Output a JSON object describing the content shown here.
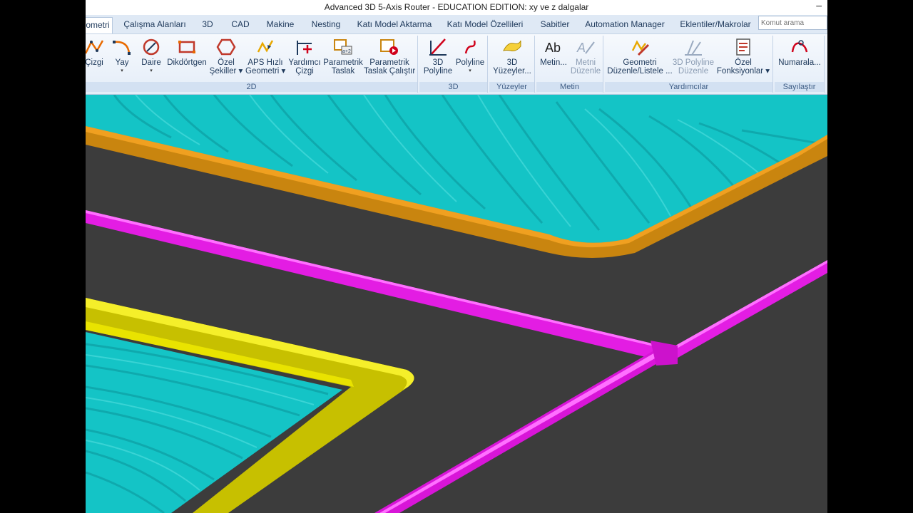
{
  "window": {
    "title": "Advanced 3D 5-Axis Router - EDUCATION EDITION: xy ve z dalgalar",
    "minimize_glyph": "–"
  },
  "tabs": [
    "ometri",
    "Çalışma Alanları",
    "3D",
    "CAD",
    "Makine",
    "Nesting",
    "Katı Model Aktarma",
    "Katı Model Özellileri",
    "Sabitler",
    "Automation Manager",
    "Eklentiler/Makrolar"
  ],
  "search": {
    "placeholder": "Komut arama"
  },
  "groups": {
    "g2d": "2D",
    "g3d": "3D",
    "yuzeyler": "Yüzeyler",
    "metin": "Metin",
    "yardimcilar": "Yardımcılar",
    "sayilastir": "Sayılaştır"
  },
  "buttons": {
    "cizgi": [
      "Çizgi",
      ""
    ],
    "yay": [
      "Yay",
      "▾"
    ],
    "daire": [
      "Daire",
      "▾"
    ],
    "dikdortgen": [
      "Dikdörtgen",
      ""
    ],
    "ozel_sekiller": [
      "Özel",
      "Şekiller ▾"
    ],
    "aps": [
      "APS Hızlı",
      "Geometri ▾"
    ],
    "yardimci_cizgi": [
      "Yardımcı",
      "Çizgi"
    ],
    "parametrik_taslak": [
      "Parametrik",
      "Taslak"
    ],
    "parametrik_calistir": [
      "Parametrik",
      "Taslak Çalıştır"
    ],
    "polyline3d": [
      "3D",
      "Polyline"
    ],
    "polyline": [
      "Polyline",
      "▾"
    ],
    "yuzeyler3d": [
      "3D",
      "Yüzeyler..."
    ],
    "metin": [
      "Metin...",
      ""
    ],
    "metni_duzenle": [
      "Metni",
      "Düzenle"
    ],
    "geometri_duzenle": [
      "Geometri",
      "Düzenle/Listele ..."
    ],
    "polyline_duzenle": [
      "3D Polyline",
      "Düzenle"
    ],
    "ozel_fonksiyonlar": [
      "Özel",
      "Fonksiyonlar ▾"
    ],
    "numarala": [
      "Numarala...",
      ""
    ]
  },
  "colors": {
    "accent": "#1e395b",
    "ribbon_bg": "#e4edf8",
    "canvas_bg": "#3c3c3c",
    "toolpath_magenta": "#e619e6",
    "teal_surface": "#12c1c4",
    "orange_edge": "#c98510",
    "yellow_edge": "#c7c000"
  },
  "icons": [
    "line-icon",
    "arc-icon",
    "circle-icon",
    "rectangle-icon",
    "hexagon-icon",
    "aps-icon",
    "guide-line-icon",
    "sketch-icon",
    "run-sketch-icon",
    "polyline3d-icon",
    "polyline-icon",
    "surface-icon",
    "text-icon",
    "edit-text-icon",
    "edit-geometry-icon",
    "edit-polyline-icon",
    "function-list-icon",
    "numbering-icon"
  ]
}
